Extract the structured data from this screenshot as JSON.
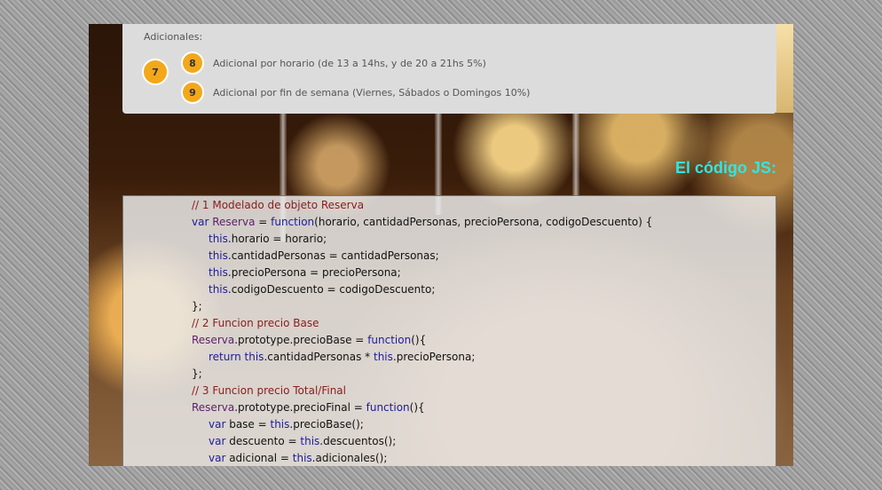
{
  "adicionales": {
    "title": "Adicionales:",
    "step_outer": "7",
    "items": [
      {
        "num": "8",
        "label": "Adicional por horario (de 13 a 14hs, y de 20 a 21hs 5%)"
      },
      {
        "num": "9",
        "label": "Adicional por fin de semana (Viernes, Sábados o Domingos 10%)"
      }
    ]
  },
  "code_section": {
    "title": "El código JS:",
    "lines": [
      "// 1 Modelado de objeto Reserva",
      "var Reserva = function(horario, cantidadPersonas, precioPersona, codigoDescuento) {",
      "this.horario = horario;",
      "this.cantidadPersonas = cantidadPersonas;",
      "this.precioPersona = precioPersona;",
      "this.codigoDescuento = codigoDescuento;",
      "};",
      "// 2 Funcion precio Base",
      "Reserva.prototype.precioBase = function(){",
      "return this.cantidadPersonas * this.precioPersona;",
      "};",
      "// 3 Funcion precio Total/Final",
      "Reserva.prototype.precioFinal = function(){",
      "var base = this.precioBase();",
      "var descuento = this.descuentos();",
      "var adicional = this.adicionales();"
    ]
  },
  "colors": {
    "badge": "#f2a81a",
    "code_title": "#2ee6e6",
    "comment": "#8a1c1c",
    "keyword": "#1c1c9a"
  }
}
